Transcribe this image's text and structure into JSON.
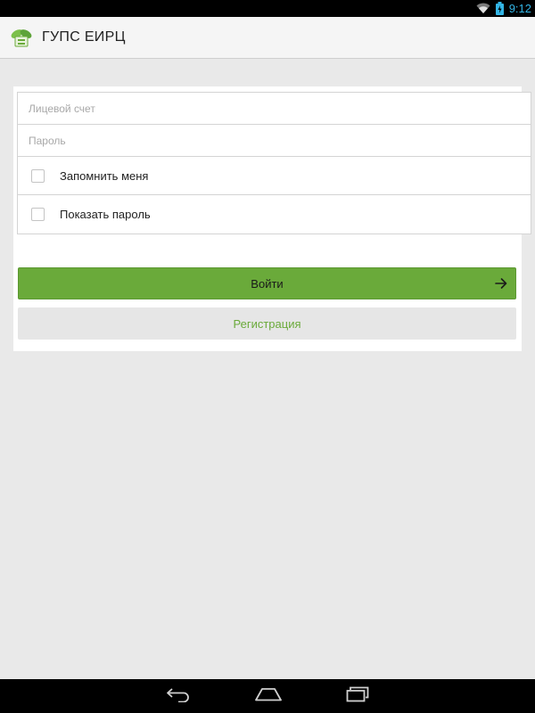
{
  "status_bar": {
    "time": "9:12",
    "icons": [
      "wifi-icon",
      "battery-icon"
    ],
    "time_color": "#33b5e5"
  },
  "action_bar": {
    "title": "ГУПС ЕИРЦ",
    "icon": "app-logo-icon"
  },
  "form": {
    "account_placeholder": "Лицевой счет",
    "account_value": "",
    "password_placeholder": "Пароль",
    "password_value": "",
    "remember_me": {
      "label": "Запомнить меня",
      "checked": false
    },
    "show_password": {
      "label": "Показать пароль",
      "checked": false
    }
  },
  "buttons": {
    "login_label": "Войти",
    "login_icon": "arrow-right-icon",
    "register_label": "Регистрация"
  },
  "colors": {
    "accent": "#6aaa3a",
    "background": "#e9e9e9"
  },
  "nav_bar": {
    "icons": [
      "back-icon",
      "home-icon",
      "recent-apps-icon"
    ]
  }
}
